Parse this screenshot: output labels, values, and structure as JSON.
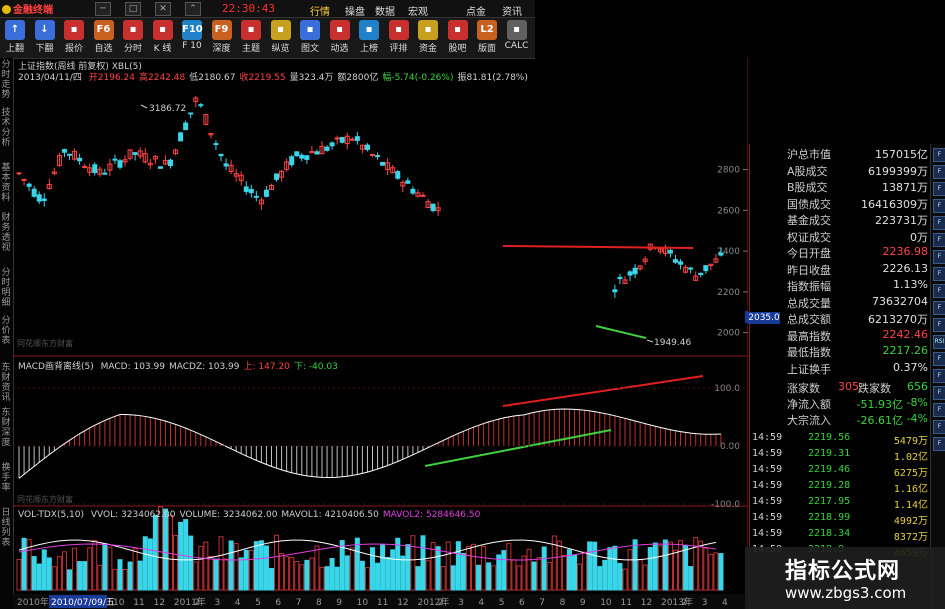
{
  "top_bar": {
    "app_title": "金融终端",
    "clock": "22:30:43",
    "menu": [
      "行情",
      "操盘",
      "数据",
      "宏观",
      "点金",
      "资讯"
    ]
  },
  "toolbar": {
    "buttons": [
      {
        "label": "上翻",
        "icon": "arrow-up-icon"
      },
      {
        "label": "下翻",
        "icon": "arrow-down-icon"
      },
      {
        "label": "报价",
        "icon": "quote-icon"
      },
      {
        "label": "自选",
        "icon": "f6-icon",
        "glyph": "F6"
      },
      {
        "label": "分时",
        "icon": "timeshare-icon"
      },
      {
        "label": "K 线",
        "icon": "kline-icon"
      },
      {
        "label": "F 10",
        "icon": "f10-icon",
        "glyph": "F10"
      },
      {
        "label": "深度",
        "icon": "f9-icon",
        "glyph": "F9"
      },
      {
        "label": "主题",
        "icon": "theme-icon"
      },
      {
        "label": "纵览",
        "icon": "overview-icon"
      },
      {
        "label": "图文",
        "icon": "graphic-icon"
      },
      {
        "label": "动选",
        "icon": "dynamic-select-icon"
      },
      {
        "label": "上榜",
        "icon": "ranking-icon"
      },
      {
        "label": "评排",
        "icon": "rating-icon"
      },
      {
        "label": "资金",
        "icon": "funds-icon"
      },
      {
        "label": "股吧",
        "icon": "forum-icon"
      },
      {
        "label": "版面",
        "icon": "layout-icon",
        "glyph": "L2"
      },
      {
        "label": "CALC",
        "icon": "calculator-icon"
      }
    ]
  },
  "left_tabs": [
    "分时走势",
    "技术分析",
    "基本资料",
    "财务透视",
    "分时明细",
    "分价表",
    "东财资讯",
    "东财深度",
    "换手率",
    "日线列表"
  ],
  "main_chart": {
    "title": "上证指数(周线 前复权) XBL(5)",
    "info_date": "2013/04/11/四",
    "info": [
      {
        "text": "开2196.24",
        "color": "#ff4444"
      },
      {
        "text": "高2242.48",
        "color": "#ff4444"
      },
      {
        "text": "低2180.67",
        "color": "#d0d0d0"
      },
      {
        "text": "收2219.55",
        "color": "#ff4444"
      },
      {
        "text": "量323.4万",
        "color": "#d0d0d0"
      },
      {
        "text": "额2800亿",
        "color": "#d0d0d0"
      },
      {
        "text": "幅-5.74(-0.26%)",
        "color": "#3ad23a"
      },
      {
        "text": "振81.81(2.78%)",
        "color": "#d0d0d0"
      }
    ],
    "y_ticks": [
      "2800",
      "2600",
      "2400",
      "2200",
      "2000"
    ],
    "high_label": "3186.72",
    "low_label": "1949.46",
    "cursor_value": "2035.0",
    "watermark": "同花顺东方财富"
  },
  "macd_panel": {
    "title": "MACD画背离线(5)",
    "items": [
      {
        "text": "MACD: 103.99",
        "color": "#d0d0d0"
      },
      {
        "text": "MACDZ: 103.99",
        "color": "#d0d0d0"
      },
      {
        "text": "上: 147.20",
        "color": "#ff4444"
      },
      {
        "text": "下: -40.03",
        "color": "#3ad23a"
      }
    ],
    "y_ticks": [
      "100.0",
      "0.00",
      "-100.0"
    ],
    "watermark": "同花顺东方财富"
  },
  "vol_panel": {
    "title": "VOL-TDX(5,10)",
    "items": [
      {
        "text": "VVOL: 3234062.00",
        "color": "#d0d0d0"
      },
      {
        "text": "VOLUME: 3234062.00",
        "color": "#d0d0d0"
      },
      {
        "text": "MAVOL1: 4210406.50",
        "color": "#d0d0d0"
      },
      {
        "text": "MAVOL2: 5284646.50",
        "color": "#e040e0"
      }
    ]
  },
  "x_axis": [
    "2010年",
    "2010/07/09/五",
    "10",
    "11",
    "12",
    "2011年",
    "2",
    "3",
    "4",
    "5",
    "6",
    "7",
    "8",
    "9",
    "10",
    "11",
    "12",
    "2012年",
    "2",
    "3",
    "4",
    "5",
    "6",
    "7",
    "8",
    "9",
    "10",
    "11",
    "12",
    "2013年",
    "2",
    "3",
    "4"
  ],
  "stats": [
    {
      "label": "沪总市值",
      "value": "157015亿",
      "color": "#e0e0e0"
    },
    {
      "label": "A股成交",
      "value": "6199399万",
      "color": "#e0e0e0"
    },
    {
      "label": "B股成交",
      "value": "13871万",
      "color": "#e0e0e0"
    },
    {
      "label": "国债成交",
      "value": "16416309万",
      "color": "#e0e0e0"
    },
    {
      "label": "基金成交",
      "value": "223731万",
      "color": "#e0e0e0"
    },
    {
      "label": "权证成交",
      "value": "0万",
      "color": "#e0e0e0"
    },
    {
      "label": "今日开盘",
      "value": "2236.98",
      "color": "#ff4444"
    },
    {
      "label": "昨日收盘",
      "value": "2226.13",
      "color": "#e0e0e0"
    },
    {
      "label": "指数振幅",
      "value": "1.13%",
      "color": "#e0e0e0"
    },
    {
      "label": "总成交量",
      "value": "73632704",
      "color": "#e0e0e0"
    },
    {
      "label": "总成交额",
      "value": "6213270万",
      "color": "#e0e0e0"
    },
    {
      "label": "最高指数",
      "value": "2242.46",
      "color": "#ff4444"
    },
    {
      "label": "最低指数",
      "value": "2217.26",
      "color": "#3ad23a"
    },
    {
      "label": "上证换手",
      "value": "0.37%",
      "color": "#e0e0e0"
    }
  ],
  "updown": {
    "up_label": "涨家数",
    "up": "305",
    "down_label": "跌家数",
    "down": "656"
  },
  "flows": [
    {
      "label": "净流入额",
      "value": "-51.93亿",
      "pct": "-8%"
    },
    {
      "label": "大宗流入",
      "value": "-26.61亿",
      "pct": "-4%"
    }
  ],
  "ticks": [
    {
      "time": "14:59",
      "price": "2219.56",
      "vol": "5479万"
    },
    {
      "time": "14:59",
      "price": "2219.31",
      "vol": "1.02亿"
    },
    {
      "time": "14:59",
      "price": "2219.46",
      "vol": "6275万"
    },
    {
      "time": "14:59",
      "price": "2219.28",
      "vol": "1.16亿"
    },
    {
      "time": "14:59",
      "price": "2217.95",
      "vol": "1.14亿"
    },
    {
      "time": "14:59",
      "price": "2218.99",
      "vol": "4992万"
    },
    {
      "time": "14:59",
      "price": "2218.34",
      "vol": "8372万"
    },
    {
      "time": "14:59",
      "price": "2218.9",
      "vol": "4659万"
    }
  ],
  "right_side_buttons": [
    "F",
    "F",
    "F",
    "F",
    "F",
    "F",
    "F",
    "F",
    "F",
    "F",
    "F",
    "RSI",
    "F",
    "F",
    "F",
    "F",
    "F",
    "F"
  ],
  "watermark_site": {
    "title": "指标公式网",
    "url": "www.zbgs3.com"
  },
  "colors": {
    "up": "#ff4444",
    "down": "#3ad23a",
    "candle_down": "#38d6e8",
    "divider": "#8a1c1c"
  }
}
